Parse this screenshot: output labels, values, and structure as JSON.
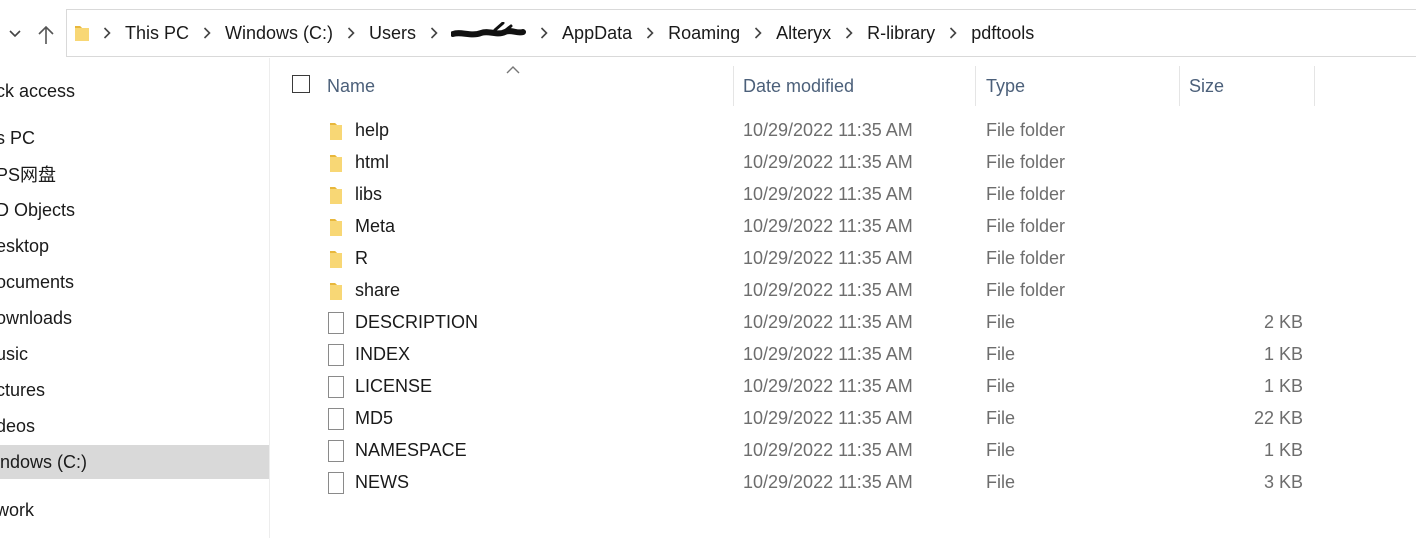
{
  "window": {
    "title": "pdftools"
  },
  "breadcrumb": [
    {
      "label": "This PC",
      "redacted": false
    },
    {
      "label": "Windows (C:)",
      "redacted": false
    },
    {
      "label": "Users",
      "redacted": false
    },
    {
      "label": "",
      "redacted": true
    },
    {
      "label": "AppData",
      "redacted": false
    },
    {
      "label": "Roaming",
      "redacted": false
    },
    {
      "label": "Alteryx",
      "redacted": false
    },
    {
      "label": "R-library",
      "redacted": false
    },
    {
      "label": "pdftools",
      "redacted": false
    }
  ],
  "sidebar": {
    "items": [
      {
        "label": "ck access",
        "selected": false
      },
      {
        "label": "s PC",
        "selected": false
      },
      {
        "label": "PS网盘",
        "selected": false
      },
      {
        "label": "D Objects",
        "selected": false
      },
      {
        "label": "esktop",
        "selected": false
      },
      {
        "label": "ocuments",
        "selected": false
      },
      {
        "label": "ownloads",
        "selected": false
      },
      {
        "label": "usic",
        "selected": false
      },
      {
        "label": "ctures",
        "selected": false
      },
      {
        "label": "deos",
        "selected": false
      },
      {
        "label": "indows (C:)",
        "selected": true
      },
      {
        "label": "work",
        "selected": false
      }
    ]
  },
  "columns": {
    "name": "Name",
    "date_modified": "Date modified",
    "type": "Type",
    "size": "Size"
  },
  "files": [
    {
      "name": "help",
      "date": "10/29/2022 11:35 AM",
      "type": "File folder",
      "size": "",
      "icon": "folder-icon"
    },
    {
      "name": "html",
      "date": "10/29/2022 11:35 AM",
      "type": "File folder",
      "size": "",
      "icon": "folder-icon"
    },
    {
      "name": "libs",
      "date": "10/29/2022 11:35 AM",
      "type": "File folder",
      "size": "",
      "icon": "folder-icon"
    },
    {
      "name": "Meta",
      "date": "10/29/2022 11:35 AM",
      "type": "File folder",
      "size": "",
      "icon": "folder-icon"
    },
    {
      "name": "R",
      "date": "10/29/2022 11:35 AM",
      "type": "File folder",
      "size": "",
      "icon": "folder-icon"
    },
    {
      "name": "share",
      "date": "10/29/2022 11:35 AM",
      "type": "File folder",
      "size": "",
      "icon": "folder-icon"
    },
    {
      "name": "DESCRIPTION",
      "date": "10/29/2022 11:35 AM",
      "type": "File",
      "size": "2 KB",
      "icon": "file-icon"
    },
    {
      "name": "INDEX",
      "date": "10/29/2022 11:35 AM",
      "type": "File",
      "size": "1 KB",
      "icon": "file-icon"
    },
    {
      "name": "LICENSE",
      "date": "10/29/2022 11:35 AM",
      "type": "File",
      "size": "1 KB",
      "icon": "file-icon"
    },
    {
      "name": "MD5",
      "date": "10/29/2022 11:35 AM",
      "type": "File",
      "size": "22 KB",
      "icon": "file-icon"
    },
    {
      "name": "NAMESPACE",
      "date": "10/29/2022 11:35 AM",
      "type": "File",
      "size": "1 KB",
      "icon": "file-icon"
    },
    {
      "name": "NEWS",
      "date": "10/29/2022 11:35 AM",
      "type": "File",
      "size": "3 KB",
      "icon": "file-icon"
    }
  ],
  "colors": {
    "folder": "#f8d775",
    "folder_dark": "#e8b73c",
    "header_text": "#4c607a",
    "selected_bg": "#d9d9d9",
    "secondary_text": "#6d6d6d"
  }
}
